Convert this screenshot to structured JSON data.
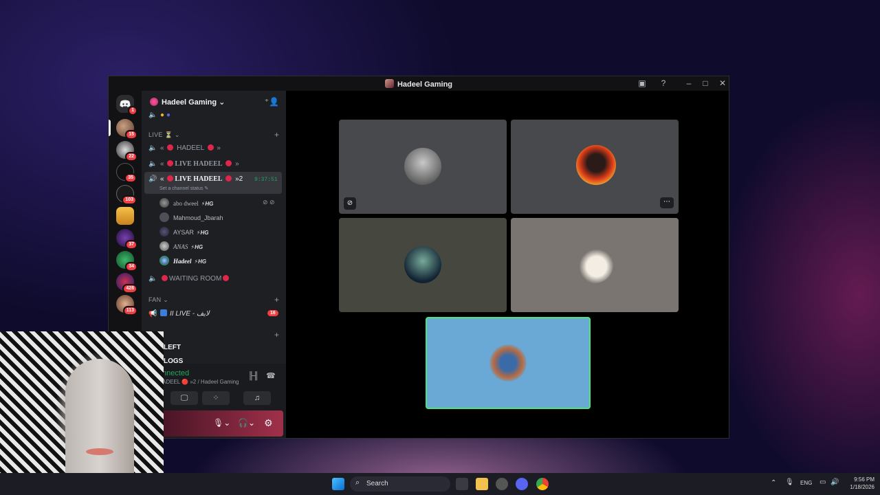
{
  "window": {
    "title": "Hadeel Gaming"
  },
  "titlebar_icons": [
    "inbox-icon",
    "help-icon",
    "minimize-icon",
    "maximize-icon",
    "close-icon"
  ],
  "server_rail": {
    "home_badge": "1",
    "servers": [
      {
        "badge": "15"
      },
      {
        "badge": "22"
      },
      {
        "badge": "35"
      },
      {
        "badge": "103"
      },
      {
        "badge": ""
      },
      {
        "badge": "37"
      },
      {
        "badge": "34"
      },
      {
        "badge": "428"
      },
      {
        "badge": "113"
      }
    ]
  },
  "server": {
    "name": "Hadeel Gaming"
  },
  "categories": {
    "live": "LIVE ⏳",
    "fan": "FAN"
  },
  "channels": {
    "c1": {
      "left": "«",
      "name": "HADEEL",
      "right": "»"
    },
    "c2": {
      "left": "«",
      "name": "LIVE HADEEL",
      "right": "»"
    },
    "c3": {
      "left": "«",
      "name": "LIVE HADEEL",
      "right": "»2",
      "timer": "9:37:51",
      "status": "Set a channel status"
    },
    "waiting": "WAITING ROOM",
    "fan_live": "II LIVE - لايف",
    "fan_badge": "16"
  },
  "members": [
    {
      "name": "abo dweel",
      "tag": "⚡HG"
    },
    {
      "name": "Mahmoud_Jbarah",
      "tag": ""
    },
    {
      "name": "AYSAR",
      "tag": "⚡HG"
    },
    {
      "name": "ANAS",
      "tag": "⚡HG"
    },
    {
      "name": "Hadeel",
      "tag": "⚡HG"
    }
  ],
  "partial_channels": [
    "LEFT",
    "LOGS"
  ],
  "voice_panel": {
    "status": "nnected",
    "location": "ADEEL 🔴 »2 / Hadeel Gaming"
  },
  "taskbar": {
    "search_placeholder": "Search",
    "lang": "ENG",
    "time": "9:56 PM",
    "date": "1/18/2026"
  },
  "colors": {
    "accent": "#5865f2",
    "live_red": "#e0264b",
    "connected_green": "#23a55a",
    "speaking_border": "#4ee37e"
  }
}
